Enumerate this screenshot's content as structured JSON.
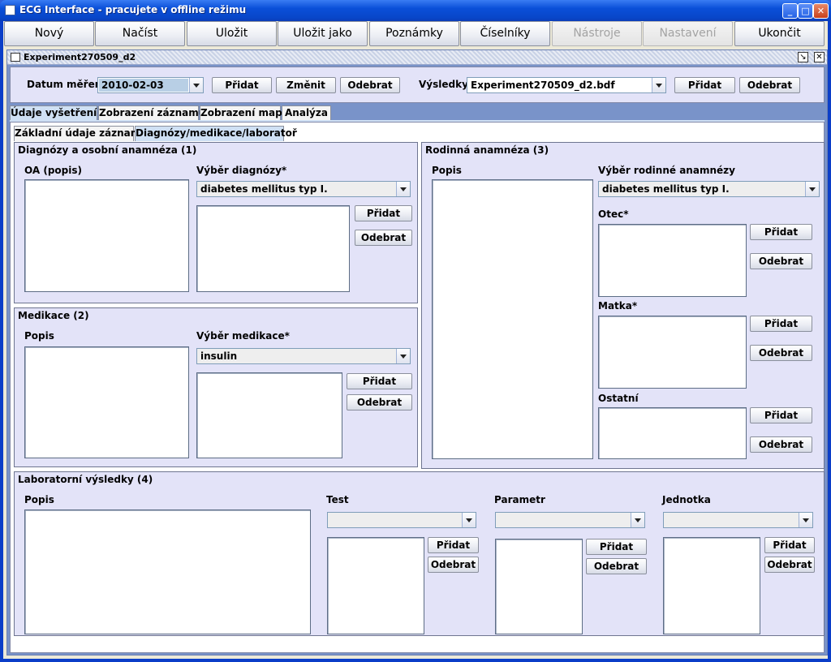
{
  "window": {
    "title": "ECG Interface - pracujete v offline režimu"
  },
  "toolbar": {
    "items": [
      {
        "label": "Nový",
        "enabled": true
      },
      {
        "label": "Načíst",
        "enabled": true
      },
      {
        "label": "Uložit",
        "enabled": true
      },
      {
        "label": "Uložit jako",
        "enabled": true
      },
      {
        "label": "Poznámky",
        "enabled": true
      },
      {
        "label": "Číselníky",
        "enabled": true
      },
      {
        "label": "Nástroje",
        "enabled": false
      },
      {
        "label": "Nastavení",
        "enabled": false
      },
      {
        "label": "Ukončit",
        "enabled": true
      }
    ]
  },
  "internal_frame": {
    "title": "Experiment270509_d2"
  },
  "top_panel": {
    "datum_label": "Datum měření",
    "datum_value": "2010-02-03",
    "add_label": "Přidat",
    "change_label": "Změnit",
    "remove_label": "Odebrat",
    "vysledky_label": "Výsledky",
    "vysledky_value": "Experiment270509_d2.bdf",
    "add2_label": "Přidat",
    "remove2_label": "Odebrat"
  },
  "main_tabs": [
    "Údaje vyšetření",
    "Zobrazení záznamu",
    "Zobrazení map",
    "Analýza"
  ],
  "sub_tabs": [
    "Základní údaje záznamu",
    "Diagnózy/medikace/laboratoř"
  ],
  "diagnozy": {
    "title": "Diagnózy a osobní anamnéza (1)",
    "oa_label": "OA (popis)",
    "select_label": "Výběr diagnózy*",
    "select_value": "diabetes mellitus typ I.",
    "add": "Přidat",
    "remove": "Odebrat"
  },
  "medikace": {
    "title": "Medikace (2)",
    "popis_label": "Popis",
    "select_label": "Výběr medikace*",
    "select_value": "insulin",
    "add": "Přidat",
    "remove": "Odebrat"
  },
  "rodinna": {
    "title": "Rodinná anamnéza (3)",
    "popis_label": "Popis",
    "select_label": "Výběr rodinné anamnézy",
    "select_value": "diabetes mellitus typ I.",
    "otec_label": "Otec*",
    "matka_label": "Matka*",
    "ostatni_label": "Ostatní",
    "add": "Přidat",
    "remove": "Odebrat"
  },
  "laborator": {
    "title": "Laboratorní výsledky (4)",
    "popis_label": "Popis",
    "test_label": "Test",
    "parametr_label": "Parametr",
    "jednotka_label": "Jednotka",
    "add": "Přidat",
    "remove": "Odebrat"
  }
}
